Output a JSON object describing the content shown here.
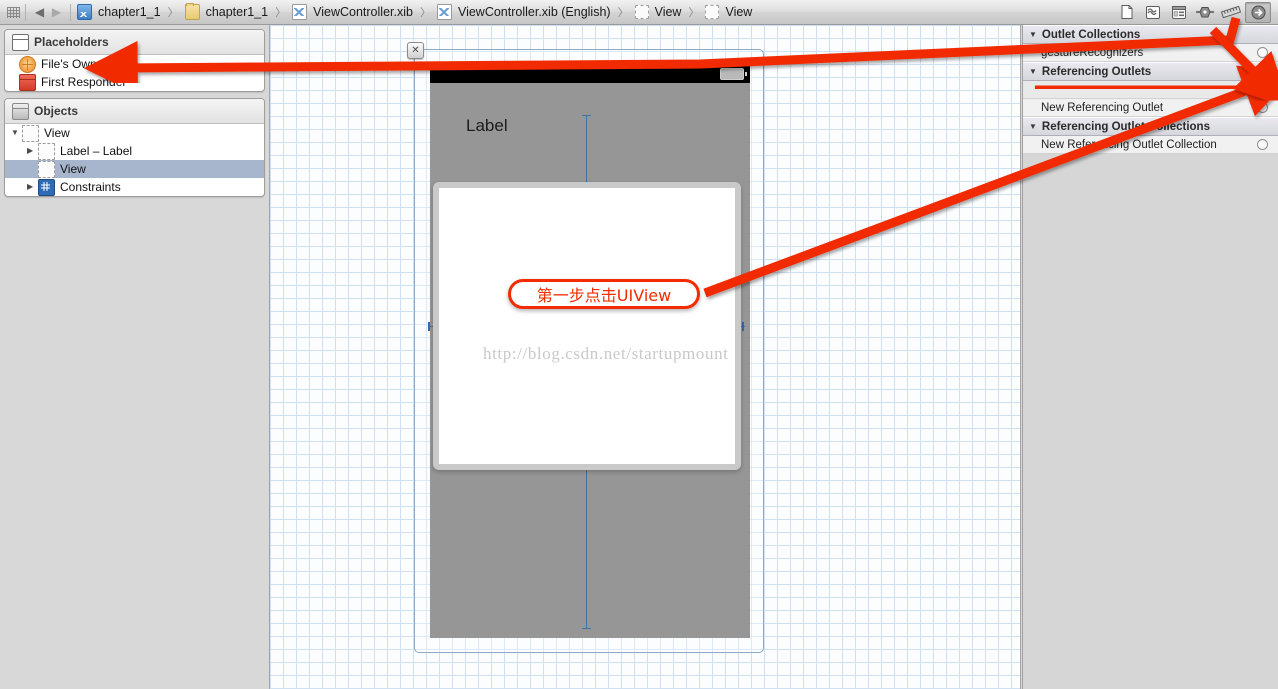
{
  "toolbar": {
    "grip_icon": "grip-icon",
    "back_label": "◀",
    "forward_label": "▶",
    "breadcrumbs": [
      {
        "label": "chapter1_1",
        "icon": "xcode-project-icon"
      },
      {
        "label": "chapter1_1",
        "icon": "folder-icon"
      },
      {
        "label": "ViewController.xib",
        "icon": "xib-file-icon"
      },
      {
        "label": "ViewController.xib (English)",
        "icon": "xib-file-icon"
      },
      {
        "label": "View",
        "icon": "view-placeholder-icon"
      },
      {
        "label": "View",
        "icon": "view-placeholder-icon"
      }
    ],
    "inspector_tabs": [
      {
        "name": "file-inspector-tab",
        "selected": false
      },
      {
        "name": "quick-help-inspector-tab",
        "selected": false
      },
      {
        "name": "identity-inspector-tab",
        "selected": false
      },
      {
        "name": "attributes-inspector-tab",
        "selected": false
      },
      {
        "name": "size-inspector-tab",
        "selected": false
      },
      {
        "name": "connections-inspector-tab",
        "selected": true
      }
    ]
  },
  "outline": {
    "placeholders": {
      "title": "Placeholders",
      "icon": "cube-outline-icon",
      "items": [
        {
          "label": "File's Owner",
          "icon": "files-owner-icon"
        },
        {
          "label": "First Responder",
          "icon": "first-responder-icon"
        }
      ]
    },
    "objects": {
      "title": "Objects",
      "icon": "cube-icon",
      "items": [
        {
          "label": "View",
          "icon": "uiview-icon",
          "disclosure": "▼",
          "selected": false
        },
        {
          "label": "Label – Label",
          "icon": "uiview-icon",
          "disclosure": "▶",
          "selected": false
        },
        {
          "label": "View",
          "icon": "uiview-icon",
          "disclosure": "",
          "selected": true
        },
        {
          "label": "Constraints",
          "icon": "constraints-icon",
          "disclosure": "▶",
          "selected": false
        }
      ]
    }
  },
  "canvas": {
    "close_button_label": "✕",
    "label_object_text": "Label",
    "watermark": "http://blog.csdn.net/startupmount"
  },
  "inspector": {
    "sections": [
      {
        "title": "Outlet Collections",
        "disclosure": "▼",
        "rows": [
          {
            "label": "gestureRecognizers",
            "connected": false
          }
        ]
      },
      {
        "title": "Referencing Outlets",
        "disclosure": "▼",
        "rows": [
          {
            "label": "",
            "connected": true
          },
          {
            "label": "New Referencing Outlet",
            "connected": false
          }
        ]
      },
      {
        "title": "Referencing Outlet Collections",
        "disclosure": "▼",
        "rows": [
          {
            "label": "New Referencing Outlet Collection",
            "connected": false
          }
        ]
      }
    ]
  },
  "annotations": {
    "callout_text": "第一步点击UIView",
    "accent_color": "#f22b00"
  }
}
